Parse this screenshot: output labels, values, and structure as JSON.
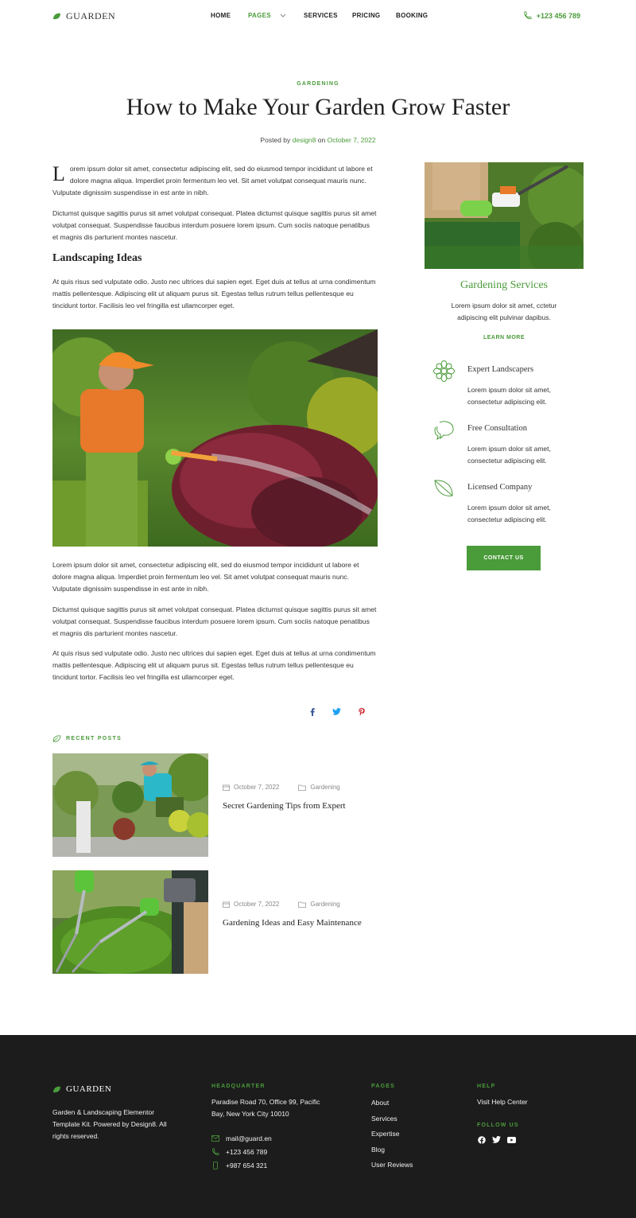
{
  "brand": {
    "name": "GUARDEN"
  },
  "nav": {
    "home": "HOME",
    "pages": "PAGES",
    "services": "SERVICES",
    "pricing": "PRICING",
    "booking": "BOOKING",
    "phone": "+123 456 789"
  },
  "article": {
    "category": "GARDENING",
    "title": "How to Make Your Garden Grow Faster",
    "posted_by_label": "Posted by",
    "author": "design8",
    "on_label": "on",
    "date": "October 7, 2022",
    "dropcap": "L",
    "p1": "orem ipsum dolor sit amet, consectetur adipiscing elit, sed do eiusmod tempor incididunt ut labore et dolore magna aliqua. Imperdiet proin fermentum leo vel. Sit amet volutpat consequat mauris nunc. Vulputate dignissim suspendisse in est ante in nibh.",
    "p2": "Dictumst quisque sagittis purus sit amet volutpat consequat. Platea dictumst quisque sagittis purus sit amet volutpat consequat. Suspendisse faucibus interdum posuere lorem ipsum. Cum sociis natoque penatibus et magnis dis parturient montes nascetur.",
    "subheading": "Landscaping Ideas",
    "p3": "At quis risus sed vulputate odio. Justo nec ultrices dui sapien eget. Eget duis at tellus at urna condimentum mattis pellentesque. Adipiscing elit ut aliquam purus sit. Egestas tellus rutrum tellus pellentesque eu tincidunt tortor. Facilisis leo vel fringilla est ullamcorper eget.",
    "p4": "Lorem ipsum dolor sit amet, consectetur adipiscing elit, sed do eiusmod tempor incididunt ut labore et dolore magna aliqua. Imperdiet proin fermentum leo vel. Sit amet volutpat consequat mauris nunc. Vulputate dignissim suspendisse in est ante in nibh.",
    "p5": "Dictumst quisque sagittis purus sit amet volutpat consequat. Platea dictumst quisque sagittis purus sit amet volutpat consequat. Suspendisse faucibus interdum posuere lorem ipsum. Cum sociis natoque penatibus et magnis dis parturient montes nascetur.",
    "p6": "At quis risus sed vulputate odio. Justo nec ultrices dui sapien eget. Eget duis at tellus at urna condimentum mattis pellentesque. Adipiscing elit ut aliquam purus sit. Egestas tellus rutrum tellus pellentesque eu tincidunt tortor. Facilisis leo vel fringilla est ullamcorper eget."
  },
  "share": {
    "icons": [
      "facebook-icon",
      "twitter-icon",
      "pinterest-icon"
    ]
  },
  "recent": {
    "label": "RECENT POSTS",
    "posts": [
      {
        "date": "October 7, 2022",
        "category": "Gardening",
        "title": "Secret Gardening Tips from Expert"
      },
      {
        "date": "October 7, 2022",
        "category": "Gardening",
        "title": "Gardening Ideas and Easy Maintenance"
      }
    ]
  },
  "sidebar": {
    "title": "Gardening Services",
    "text": "Lorem ipsum dolor sit amet, cctetur adipiscing elit pulvinar dapibus.",
    "link": "LEARN MORE",
    "features": [
      {
        "icon": "flower-icon",
        "title": "Expert Landscapers",
        "text": "Lorem ipsum dolor sit amet, consectetur adipiscing elit."
      },
      {
        "icon": "chat-icon",
        "title": "Free Consultation",
        "text": "Lorem ipsum dolor sit amet, consectetur adipiscing elit."
      },
      {
        "icon": "leaf-icon",
        "title": "Licensed Company",
        "text": "Lorem ipsum dolor sit amet, consectetur adipiscing elit."
      }
    ],
    "button": "CONTACT US"
  },
  "footer": {
    "brand": "GUARDEN",
    "description": "Garden & Landscaping Elementor Template Kit. Powered by Design8. All rights reserved.",
    "hq_label": "HEADQUARTER",
    "address": "Paradise Road 70, Office 99, Pacific Bay,  New York City 10010",
    "email": "mail@guard.en",
    "phone1": "+123 456 789",
    "phone2": "+987 654 321",
    "pages_label": "PAGES",
    "pages": [
      "About",
      "Services",
      "Expertise",
      "Blog",
      "User Reviews"
    ],
    "help_label": "HELP",
    "help_link": "Visit Help Center",
    "follow_label": "FOLLOW US",
    "social": [
      "facebook-icon",
      "twitter-icon",
      "youtube-icon"
    ]
  },
  "colors": {
    "accent": "#4a9b3a",
    "footer_bg": "#1c1c1c"
  }
}
